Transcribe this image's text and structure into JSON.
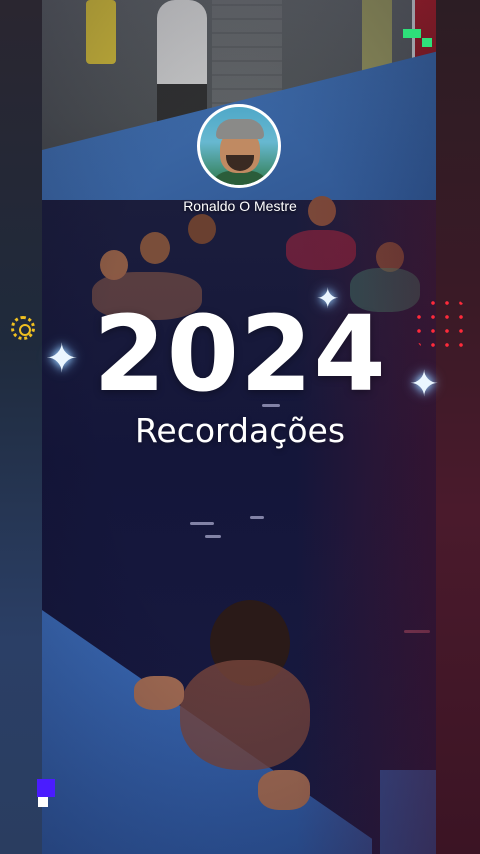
{
  "story": {
    "user_name": "Ronaldo O Mestre",
    "year": "2024",
    "subtitle": "Recordações"
  },
  "decorations": {
    "sparkle_icon": "four-point-star",
    "left_badge_icon": "dotted-gear-icon",
    "right_badge_icon": "red-dot-pattern",
    "colors": {
      "accent_blue": "#3b6bb6",
      "accent_red": "#ff2a3a",
      "accent_yellow": "#f0c020",
      "accent_green": "#2ee07a",
      "accent_purple": "#4a1cff"
    }
  }
}
